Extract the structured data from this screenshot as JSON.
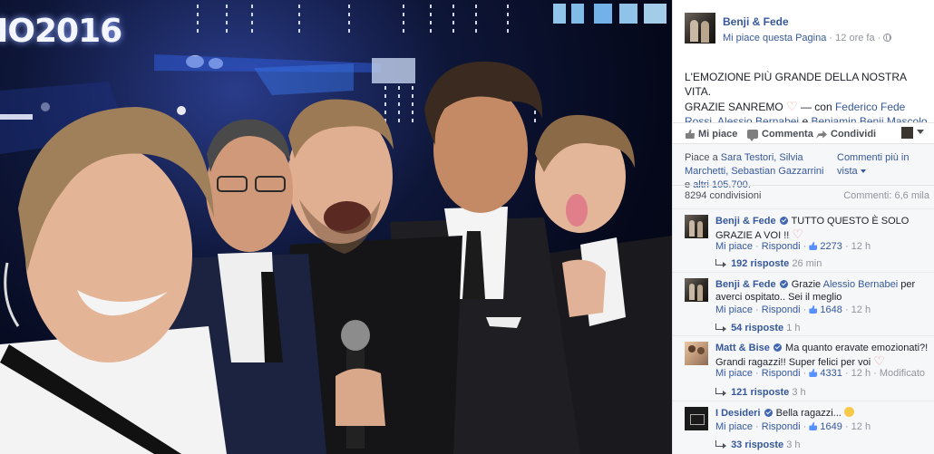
{
  "photo": {
    "logo_text": "IO2016"
  },
  "post": {
    "page_name": "Benji & Fede",
    "like_page": "Mi piace questa Pagina",
    "time": "12 ore fa",
    "text_line": "L'EMOZIONE PIÙ GRANDE DELLA NOSTRA VITA.",
    "text_line2": "GRAZIE SANREMO",
    "with": "— con",
    "tag1": "Federico Fede Rossi",
    "tag2": "Alessio Bernabei",
    "and": "e",
    "tag3": "Benjamin Benji Mascolo"
  },
  "actions": {
    "like": "Mi piace",
    "comment": "Commenta",
    "share": "Condividi"
  },
  "stats": {
    "likes_prefix": "Piace a",
    "likes_names": "Sara Testori, Silvia Marchetti, Sebastian Gazzarrini",
    "likes_and": "e",
    "likes_others": "altri 105.700.",
    "order": "Commenti più in vista",
    "shares": "8294 condivisioni",
    "comments_count": "Commenti: 6,6 mila"
  },
  "comments": [
    {
      "author": "Benji & Fede",
      "text": "TUTTO QUESTO È SOLO GRAZIE A VOI !!",
      "like": "Mi piace",
      "reply": "Rispondi",
      "likes": "2273",
      "time": "12 h",
      "replies": "192 risposte",
      "replies_time": "26 min"
    },
    {
      "author": "Benji & Fede",
      "text_prefix": "Grazie",
      "text_tag": "Alessio Bernabei",
      "text_suffix": "per averci ospitato.. Sei il meglio",
      "like": "Mi piace",
      "reply": "Rispondi",
      "likes": "1648",
      "time": "12 h",
      "replies": "54 risposte",
      "replies_time": "1 h"
    },
    {
      "author": "Matt & Bise",
      "text": "Ma quanto eravate emozionati?! Grandi ragazzi!! Super felici per voi",
      "like": "Mi piace",
      "reply": "Rispondi",
      "likes": "4331",
      "time": "12 h",
      "edited": "Modificato",
      "replies": "121 risposte",
      "replies_time": "3 h"
    },
    {
      "author": "I Desideri",
      "text": "Bella ragazzi...",
      "like": "Mi piace",
      "reply": "Rispondi",
      "likes": "1649",
      "time": "12 h",
      "replies": "33 risposte",
      "replies_time": "3 h"
    }
  ]
}
